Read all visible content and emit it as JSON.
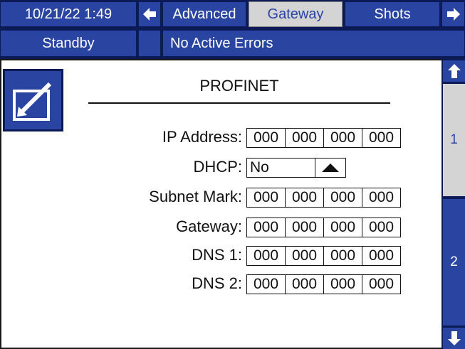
{
  "header": {
    "datetime": "10/21/22 1:49",
    "tabs": [
      {
        "label": "Advanced"
      },
      {
        "label": "Gateway"
      },
      {
        "label": "Shots"
      }
    ]
  },
  "status": {
    "mode": "Standby",
    "errors": "No Active Errors"
  },
  "main": {
    "title": "PROFINET",
    "fields": [
      {
        "label": "IP Address:",
        "octets": [
          "000",
          "000",
          "000",
          "000"
        ]
      },
      {
        "label": "Subnet Mark:",
        "octets": [
          "000",
          "000",
          "000",
          "000"
        ]
      },
      {
        "label": "Gateway:",
        "octets": [
          "000",
          "000",
          "000",
          "000"
        ]
      },
      {
        "label": "DNS 1:",
        "octets": [
          "000",
          "000",
          "000",
          "000"
        ]
      },
      {
        "label": "DNS 2:",
        "octets": [
          "000",
          "000",
          "000",
          "000"
        ]
      }
    ],
    "dhcp": {
      "label": "DHCP:",
      "value": "No"
    }
  },
  "sidebar": {
    "pages": [
      {
        "label": "1"
      },
      {
        "label": "2"
      }
    ]
  },
  "colors": {
    "accent": "#2a44a2",
    "active_tab": "#d4d4d4"
  }
}
